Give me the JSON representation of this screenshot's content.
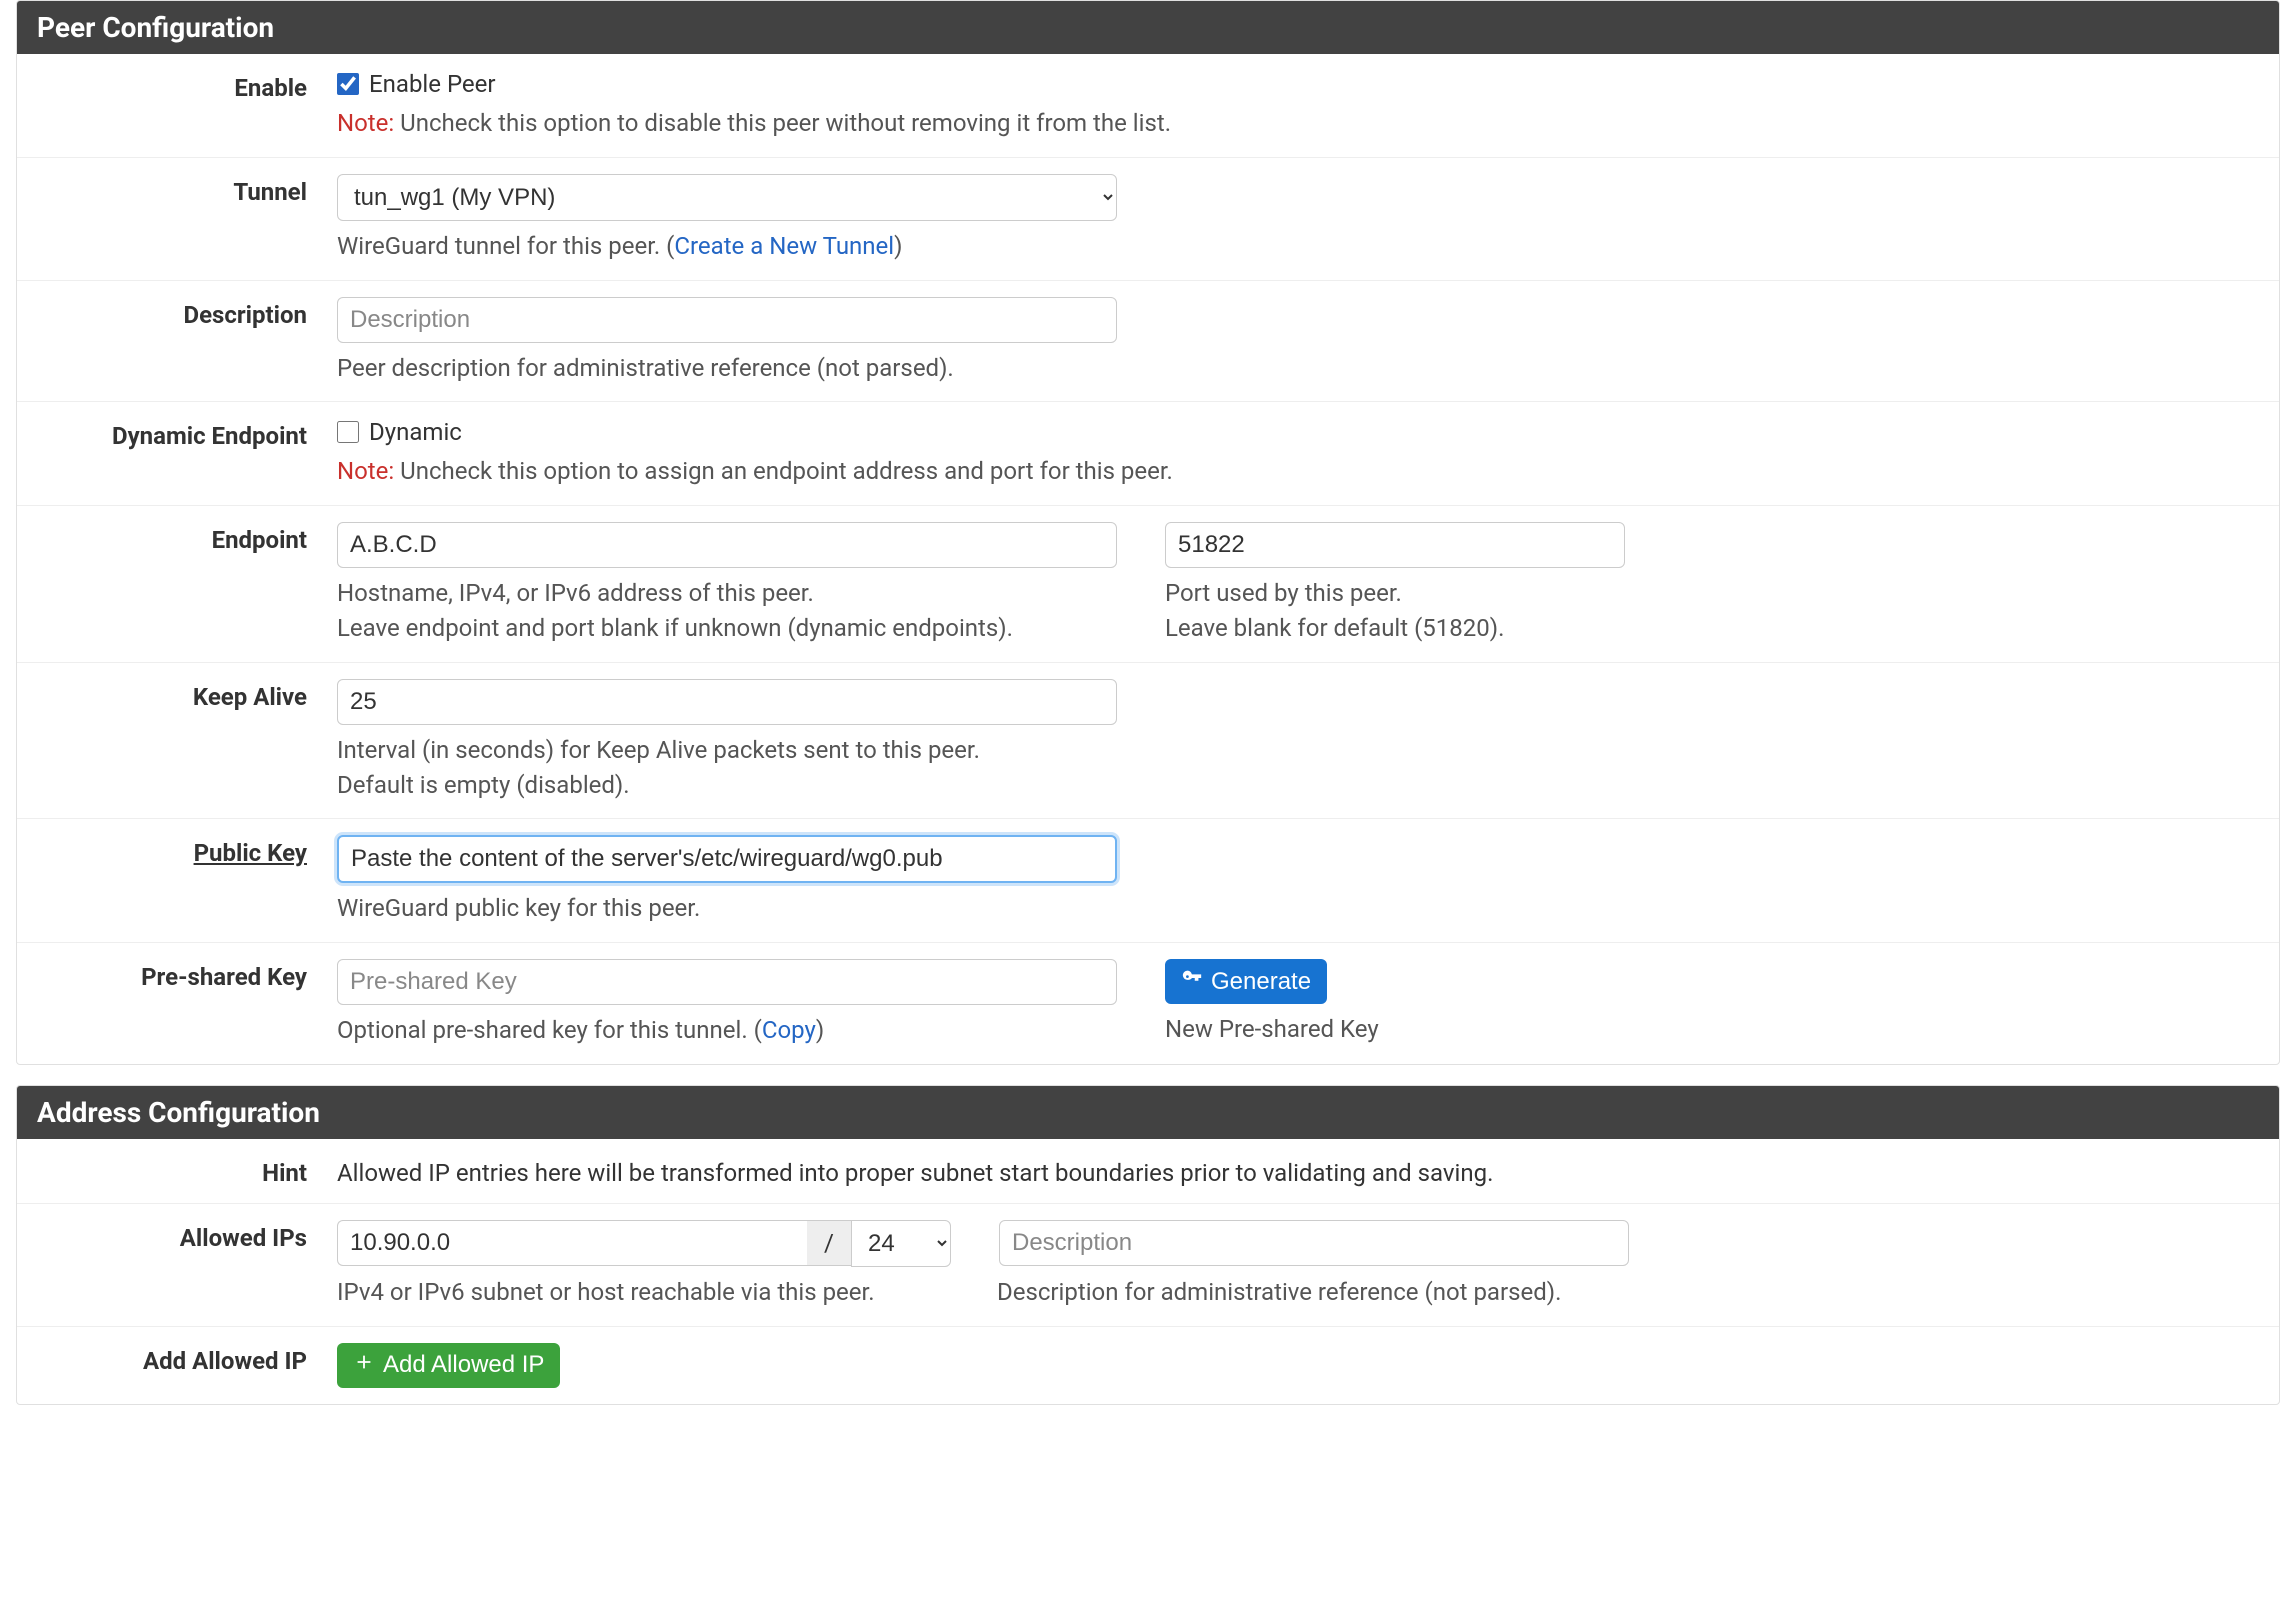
{
  "peer": {
    "title": "Peer Configuration",
    "enable": {
      "label": "Enable",
      "checkbox_label": "Enable Peer",
      "checked": true,
      "note_label": "Note:",
      "note_text": " Uncheck this option to disable this peer without removing it from the list."
    },
    "tunnel": {
      "label": "Tunnel",
      "selected": "tun_wg1 (My VPN)",
      "help_prefix": "WireGuard tunnel for this peer. (",
      "link_text": "Create a New Tunnel",
      "help_suffix": ")"
    },
    "description": {
      "label": "Description",
      "value": "",
      "placeholder": "Description",
      "help": "Peer description for administrative reference (not parsed)."
    },
    "dynamic_endpoint": {
      "label": "Dynamic Endpoint",
      "checkbox_label": "Dynamic",
      "checked": false,
      "note_label": "Note:",
      "note_text": " Uncheck this option to assign an endpoint address and port for this peer."
    },
    "endpoint": {
      "label": "Endpoint",
      "address_value": "A.B.C.D",
      "address_help_line1": "Hostname, IPv4, or IPv6 address of this peer.",
      "address_help_line2": "Leave endpoint and port blank if unknown (dynamic endpoints).",
      "port_value": "51822",
      "port_help_line1": "Port used by this peer.",
      "port_help_line2": "Leave blank for default (51820)."
    },
    "keepalive": {
      "label": "Keep Alive",
      "value": "25",
      "help_line1": "Interval (in seconds) for Keep Alive packets sent to this peer.",
      "help_line2": "Default is empty (disabled)."
    },
    "public_key": {
      "label": "Public Key",
      "value": "Paste the content of the server's/etc/wireguard/wg0.pub",
      "help": "WireGuard public key for this peer."
    },
    "preshared_key": {
      "label": "Pre-shared Key",
      "value": "",
      "placeholder": "Pre-shared Key",
      "help_prefix": "Optional pre-shared key for this tunnel. (",
      "copy_link": "Copy",
      "help_suffix": ")",
      "generate_button": "Generate",
      "generate_help": "New Pre-shared Key"
    }
  },
  "address": {
    "title": "Address Configuration",
    "hint": {
      "label": "Hint",
      "text": "Allowed IP entries here will be transformed into proper subnet start boundaries prior to validating and saving."
    },
    "allowed_ips": {
      "label": "Allowed IPs",
      "ip_value": "10.90.0.0",
      "slash": "/",
      "mask_value": "24",
      "desc_value": "",
      "desc_placeholder": "Description",
      "help_left": "IPv4 or IPv6 subnet or host reachable via this peer.",
      "help_right": "Description for administrative reference (not parsed)."
    },
    "add_allowed_ip": {
      "label": "Add Allowed IP",
      "button": "Add Allowed IP"
    }
  }
}
